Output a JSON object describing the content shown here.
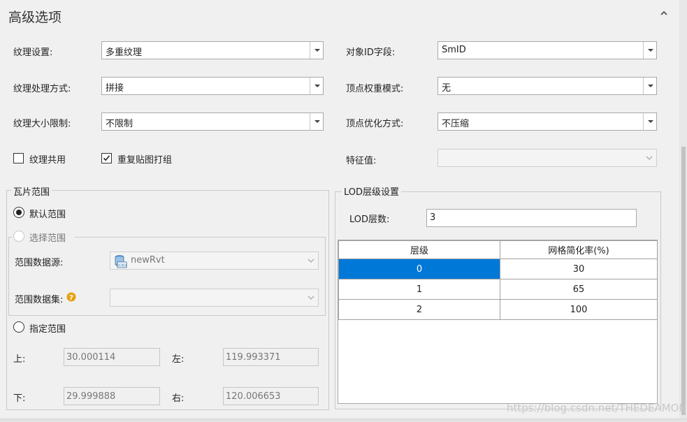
{
  "title": "高级选项",
  "texture": {
    "settings_label": "纹理设置:",
    "settings_value": "多重纹理",
    "process_label": "纹理处理方式:",
    "process_value": "拼接",
    "size_label": "纹理大小限制:",
    "size_value": "不限制",
    "shared_label": "纹理共用",
    "shared_checked": false,
    "repack_label": "重复贴图打组",
    "repack_checked": true
  },
  "object": {
    "id_label": "对象ID字段:",
    "id_value": "SmID",
    "weight_label": "顶点权重模式:",
    "weight_value": "无",
    "optimize_label": "顶点优化方式:",
    "optimize_value": "不压缩",
    "feature_label": "特征值:",
    "feature_value": ""
  },
  "tile_range": {
    "title": "瓦片范围",
    "default_label": "默认范围",
    "select_label": "选择范围",
    "source_label": "范围数据源:",
    "source_value": "newRvt",
    "source_icon": "udbx-datasource-icon",
    "dataset_label": "范围数据集:",
    "dataset_value": "",
    "specify_label": "指定范围",
    "top_label": "上:",
    "top_value": "30.000114",
    "left_label": "左:",
    "left_value": "119.993371",
    "bottom_label": "下:",
    "bottom_value": "29.999888",
    "right_label": "右:",
    "right_value": "120.006653",
    "selected": "default"
  },
  "lod": {
    "title": "LOD层级设置",
    "count_label": "LOD层数:",
    "count_value": "3",
    "columns": [
      "层级",
      "网格简化率(%)"
    ],
    "rows": [
      [
        "0",
        "30"
      ],
      [
        "1",
        "65"
      ],
      [
        "2",
        "100"
      ]
    ],
    "selected_row": 0
  },
  "watermark": "https://blog.csdn.net/THEDEAMON",
  "colors": {
    "selection": "#0078d7",
    "background": "#f0f0f0"
  }
}
